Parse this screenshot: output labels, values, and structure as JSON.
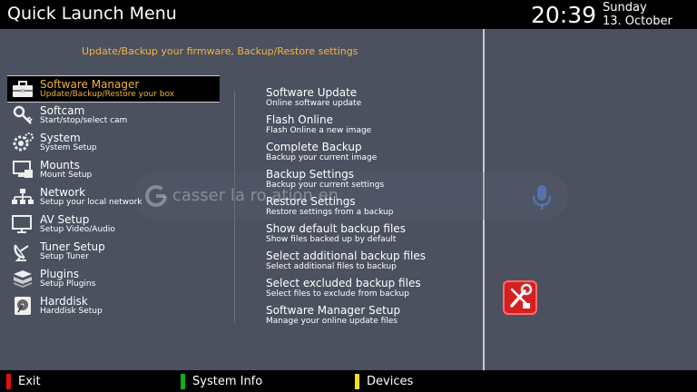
{
  "header": {
    "title": "Quick Launch Menu",
    "time": "20:39",
    "day": "Sunday",
    "date": "13. October"
  },
  "subtitle": "Update/Backup your firmware, Backup/Restore settings",
  "left_menu": [
    {
      "title": "Software Manager",
      "desc": "Update/Backup/Restore your box",
      "icon": "toolbox-icon",
      "selected": true
    },
    {
      "title": "Softcam",
      "desc": "Start/stop/select cam",
      "icon": "key-icon"
    },
    {
      "title": "System",
      "desc": "System Setup",
      "icon": "gears-icon"
    },
    {
      "title": "Mounts",
      "desc": "Mount Setup",
      "icon": "monitor-icon"
    },
    {
      "title": "Network",
      "desc": "Setup your local network",
      "icon": "network-icon"
    },
    {
      "title": "AV Setup",
      "desc": "Setup Video/Audio",
      "icon": "tv-icon"
    },
    {
      "title": "Tuner Setup",
      "desc": "Setup Tuner",
      "icon": "satellite-icon"
    },
    {
      "title": "Plugins",
      "desc": "Setup Plugins",
      "icon": "plugins-icon"
    },
    {
      "title": "Harddisk",
      "desc": "Harddisk Setup",
      "icon": "harddisk-icon"
    }
  ],
  "right_menu": [
    {
      "title": "Software Update",
      "desc": "Online software update"
    },
    {
      "title": "Flash Online",
      "desc": "Flash Online a new image"
    },
    {
      "title": "Complete Backup",
      "desc": "Backup your current image"
    },
    {
      "title": "Backup Settings",
      "desc": "Backup your current settings"
    },
    {
      "title": "Restore Settings",
      "desc": "Restore settings from a backup"
    },
    {
      "title": "Show default backup files",
      "desc": "Show files backed up by default"
    },
    {
      "title": "Select additional backup files",
      "desc": "Select additional files to backup"
    },
    {
      "title": "Select excluded backup files",
      "desc": "Select files to exclude from backup"
    },
    {
      "title": "Software Manager Setup",
      "desc": "Manage your online update files"
    }
  ],
  "overlay": {
    "text": "casser la ro   ation     en"
  },
  "footer": [
    {
      "label": "Exit",
      "color": "#e01010"
    },
    {
      "label": "System Info",
      "color": "#10b010"
    },
    {
      "label": "Devices",
      "color": "#f0e020"
    }
  ],
  "colors": {
    "background": "#4c5160",
    "accent": "#f0b43c",
    "bar": "#000000"
  }
}
